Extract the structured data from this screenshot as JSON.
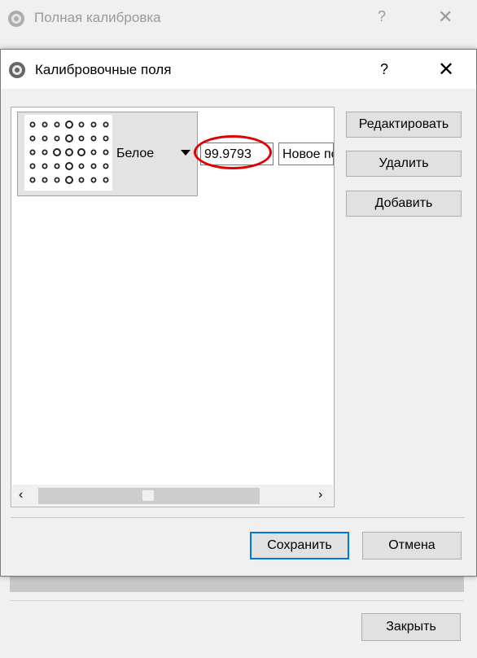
{
  "background_window": {
    "title": "Полная калибровка",
    "help_glyph": "?",
    "close_glyph": "✕",
    "close_button_label": "Закрыть"
  },
  "dialog": {
    "title": "Калибровочные поля",
    "help_glyph": "?",
    "close_glyph": "✕",
    "field_row": {
      "type_value": "Белое",
      "numeric_value": "99.9793",
      "name_value": "Новое поле"
    },
    "scrollbar": {
      "left_glyph": "‹",
      "right_glyph": "›"
    },
    "buttons": {
      "edit": "Редактировать",
      "delete": "Удалить",
      "add": "Добавить",
      "save": "Сохранить",
      "cancel": "Отмена"
    },
    "annotation_color": "#e00000",
    "focus_color": "#0078d7"
  }
}
